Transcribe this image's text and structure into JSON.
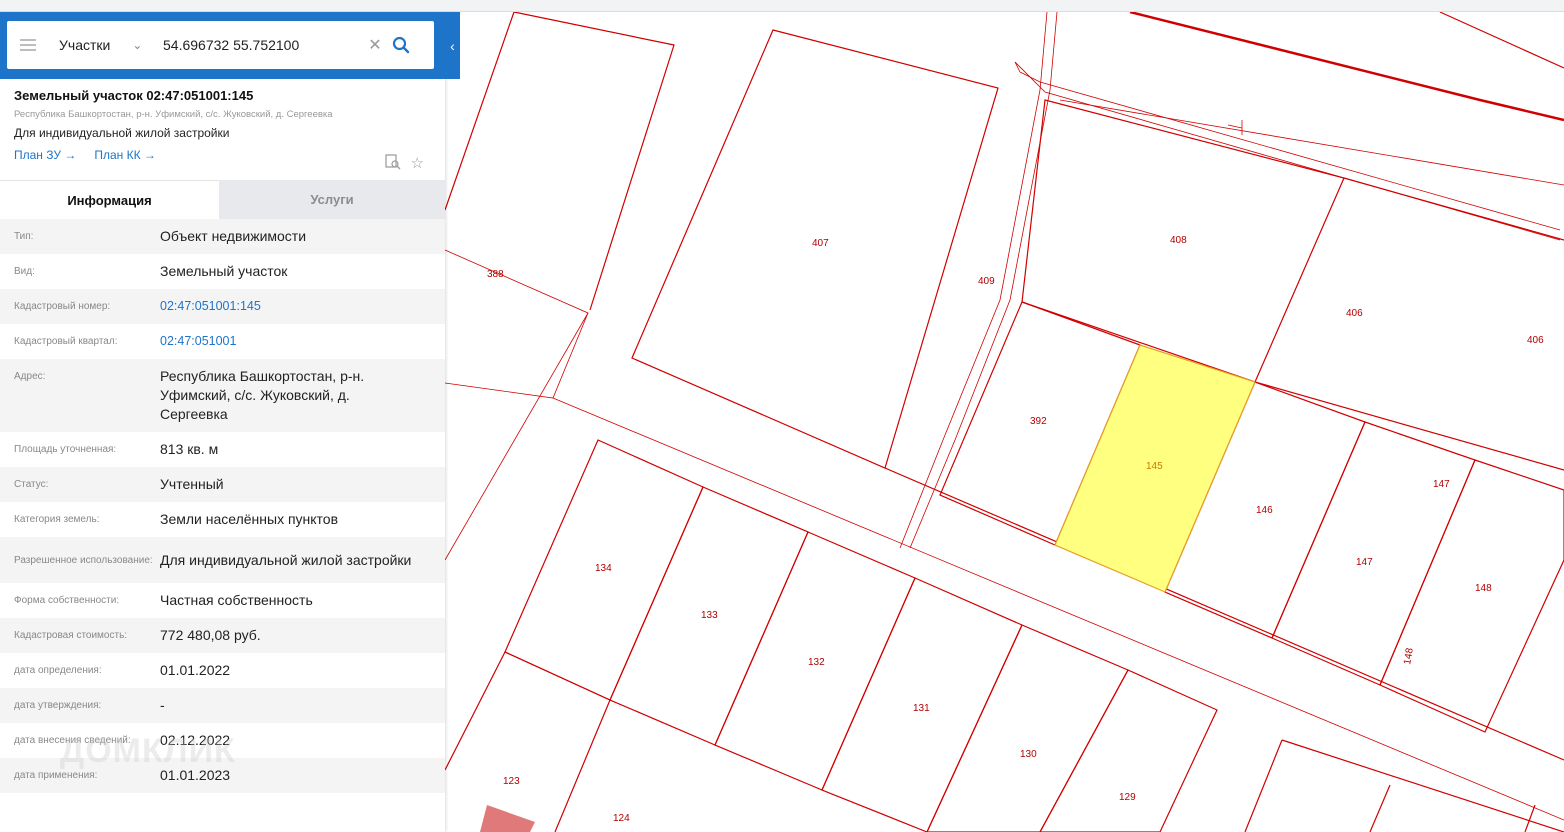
{
  "search": {
    "layer": "Участки",
    "query": "54.696732 55.752100"
  },
  "object": {
    "title": "Земельный участок 02:47:051001:145",
    "address_short": "Республика Башкортостан, р-н. Уфимский, с/с. Жуковский, д. Сергеевка",
    "usage": "Для индивидуальной жилой застройки",
    "plan_zu": "План ЗУ →",
    "plan_kk": "План КК →"
  },
  "tabs": {
    "info": "Информация",
    "services": "Услуги"
  },
  "info_rows": [
    {
      "label": "Тип:",
      "value": "Объект недвижимости"
    },
    {
      "label": "Вид:",
      "value": "Земельный участок"
    },
    {
      "label": "Кадастровый номер:",
      "value": "02:47:051001:145"
    },
    {
      "label": "Кадастровый квартал:",
      "value": "02:47:051001"
    },
    {
      "label": "Адрес:",
      "value": "Республика Башкортостан, р-н. Уфимский, с/с. Жуковский, д. Сергеевка"
    },
    {
      "label": "Площадь уточненная:",
      "value": "813 кв. м"
    },
    {
      "label": "Статус:",
      "value": "Учтенный"
    },
    {
      "label": "Категория земель:",
      "value": "Земли населённых пунктов"
    },
    {
      "label": "Разрешенное использование:",
      "value": "Для индивидуальной жилой застройки"
    },
    {
      "label": "Форма собственности:",
      "value": "Частная собственность"
    },
    {
      "label": "Кадастровая стоимость:",
      "value": "772 480,08 руб."
    },
    {
      "label": "дата определения:",
      "value": "01.01.2022"
    },
    {
      "label": "дата утверждения:",
      "value": "-"
    },
    {
      "label": "дата внесения сведений:",
      "value": "02.12.2022"
    },
    {
      "label": "дата применения:",
      "value": "01.01.2023"
    }
  ],
  "watermark": "ДОМКЛИК",
  "map": {
    "parcel_labels": {
      "p388": "388",
      "p407": "407",
      "p409": "409",
      "p408": "408",
      "p406a": "406",
      "p406b": "406",
      "p392": "392",
      "p145": "145",
      "p146": "146",
      "p147a": "147",
      "p147b": "147",
      "p148a": "148",
      "p148b": "148",
      "p134": "134",
      "p133": "133",
      "p132": "132",
      "p131": "131",
      "p130": "130",
      "p129": "129",
      "p123": "123",
      "p124": "124"
    },
    "colors": {
      "boundary": "#d00000",
      "selected_fill": "#ffff80",
      "selected_stroke": "#e6a020",
      "panel_accent": "#1e74c9"
    }
  }
}
